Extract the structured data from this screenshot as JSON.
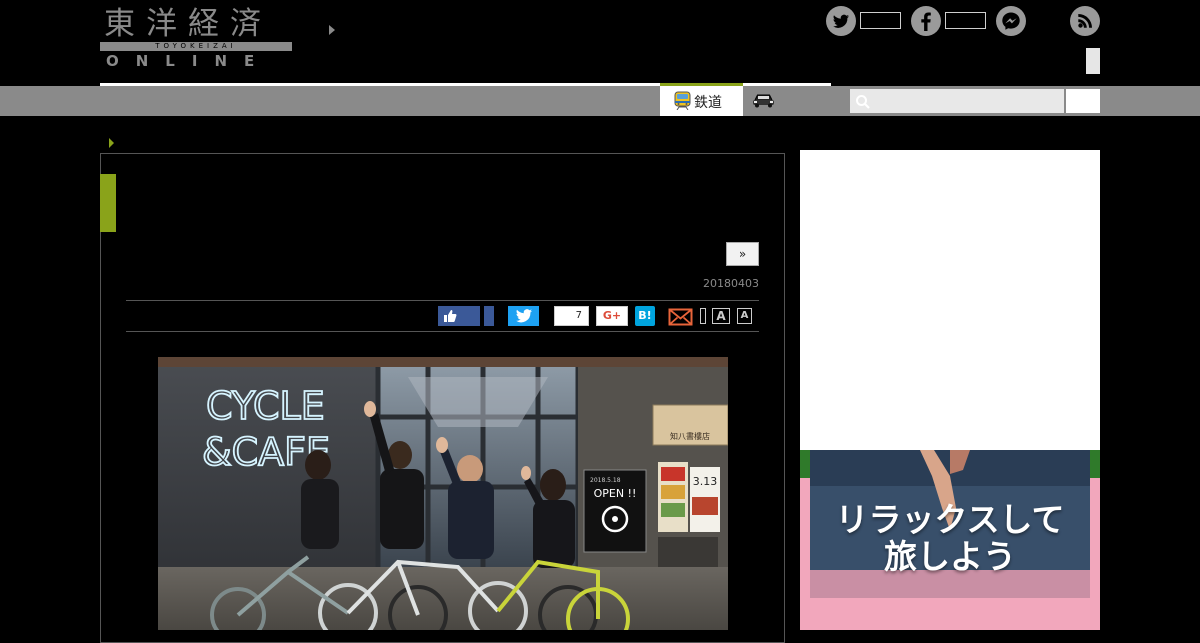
{
  "header": {
    "logo": {
      "kanji": "東洋経済",
      "roman": "TOYOKEIZAI",
      "online": "ONLINE"
    },
    "social_icons": [
      "twitter-icon",
      "facebook-icon",
      "messenger-icon",
      "rss-icon"
    ]
  },
  "nav": {
    "tabs": [
      {
        "label": "鉄道",
        "icon": "train-icon"
      },
      {
        "label": "",
        "icon": "car-icon"
      }
    ],
    "search": {
      "placeholder": "",
      "value": ""
    }
  },
  "article": {
    "next_label": "»",
    "date": "20180403",
    "share": {
      "pocket_count": "7",
      "gplus_label": "G+",
      "hatena_label": "B!"
    },
    "font_size_large": "A",
    "font_size_small": "A",
    "photo": {
      "sign_line1": "CYCLE",
      "sign_line2": "&CAFE",
      "poster_title": "OPEN !!",
      "poster_date": "2018.5.18",
      "shop_sign": "知八書樓店",
      "date_sign": "3.13"
    }
  },
  "sidebar": {
    "banner_line1": "リラックスして",
    "banner_line2": "旅しよう"
  },
  "colors": {
    "accent_green": "#8aa31a",
    "nav_gray": "#8a8a8a",
    "banner_pink": "#f2a7bc",
    "facebook_blue": "#3b5998",
    "twitter_blue": "#1da1f2",
    "hatena_blue": "#00a4de"
  }
}
